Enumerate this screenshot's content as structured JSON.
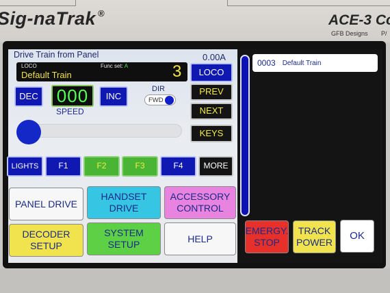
{
  "device": {
    "brand": "Sig-naTrak",
    "brand_mark": "®",
    "model": "ACE-3 Co",
    "maker": "GFB Designs",
    "maker_suffix": "P/",
    "colors": {
      "bezel": "#d2cfcb",
      "screen": "#e7e9ec",
      "navy": "#0f18b0",
      "lcd_yellow": "#f1e34a",
      "lcd_green": "#55ff55"
    }
  },
  "panel": {
    "title": "Drive Train from Panel",
    "current": "0.00A",
    "loco": {
      "label": "LOCO",
      "func_set_label": "Func set:",
      "func_set_value": "A",
      "name": "Default Train",
      "number": "3"
    },
    "speed": {
      "dec_label": "DEC",
      "value": "000",
      "inc_label": "INC",
      "label": "SPEED",
      "slider_level": 0
    },
    "direction": {
      "label": "DIR",
      "value": "FWD"
    },
    "side_buttons": {
      "loco": "LOCO",
      "prev": "PREV",
      "next": "NEXT",
      "keys": "KEYS"
    },
    "functions": {
      "lights": "LIGHTS",
      "f1": "F1",
      "f2": "F2",
      "f3": "F3",
      "f4": "F4",
      "more": "MORE"
    },
    "menu": {
      "panel_drive": "PANEL DRIVE",
      "handset_drive": "HANDSET DRIVE",
      "accessory_control": "ACCESSORY CONTROL",
      "decoder_setup": "DECODER SETUP",
      "system_setup": "SYSTEM SETUP",
      "help": "HELP"
    }
  },
  "train_list": {
    "items": [
      {
        "id": "0003",
        "name": "Default Train"
      }
    ]
  },
  "actions": {
    "emergency_stop": "EMERGY. STOP",
    "track_power": "TRACK POWER",
    "ok": "OK"
  }
}
